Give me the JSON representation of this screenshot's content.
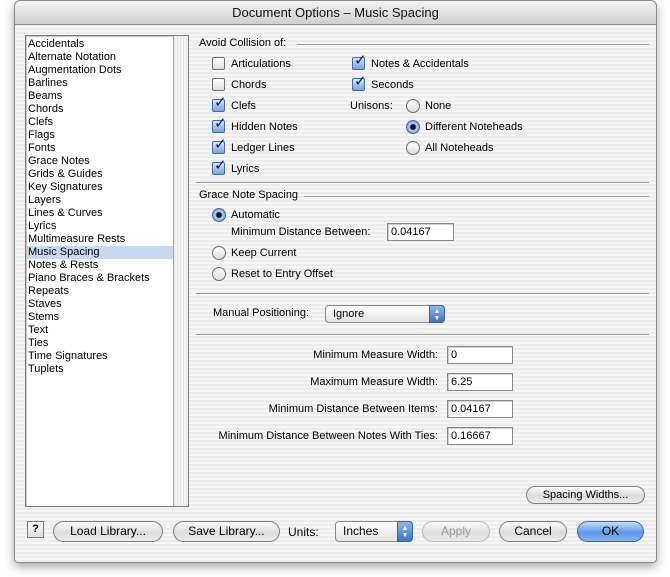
{
  "window": {
    "title": "Document Options – Music Spacing"
  },
  "sidebar": {
    "selected": "Music Spacing",
    "items": [
      "Accidentals",
      "Alternate Notation",
      "Augmentation Dots",
      "Barlines",
      "Beams",
      "Chords",
      "Clefs",
      "Flags",
      "Fonts",
      "Grace Notes",
      "Grids & Guides",
      "Key Signatures",
      "Layers",
      "Lines & Curves",
      "Lyrics",
      "Multimeasure Rests",
      "Music Spacing",
      "Notes & Rests",
      "Piano Braces & Brackets",
      "Repeats",
      "Staves",
      "Stems",
      "Text",
      "Ties",
      "Time Signatures",
      "Tuplets"
    ]
  },
  "avoid": {
    "label": "Avoid Collision of:",
    "articulations": {
      "label": "Articulations",
      "checked": false
    },
    "chords": {
      "label": "Chords",
      "checked": false
    },
    "clefs": {
      "label": "Clefs",
      "checked": true
    },
    "hidden_notes": {
      "label": "Hidden Notes",
      "checked": true
    },
    "ledger_lines": {
      "label": "Ledger Lines",
      "checked": true
    },
    "lyrics": {
      "label": "Lyrics",
      "checked": true
    },
    "notes_accidentals": {
      "label": "Notes & Accidentals",
      "checked": true
    },
    "seconds": {
      "label": "Seconds",
      "checked": true
    },
    "unisons_label": "Unisons:",
    "unisons_none": {
      "label": "None",
      "selected": false
    },
    "unisons_different": {
      "label": "Different Noteheads",
      "selected": true
    },
    "unisons_all": {
      "label": "All Noteheads",
      "selected": false
    }
  },
  "grace": {
    "label": "Grace Note Spacing",
    "automatic": {
      "label": "Automatic",
      "selected": true
    },
    "min_distance_label": "Minimum Distance Between:",
    "min_distance_value": "0.04167",
    "keep_current": {
      "label": "Keep Current",
      "selected": false
    },
    "reset_entry": {
      "label": "Reset to Entry Offset",
      "selected": false
    }
  },
  "manual": {
    "label": "Manual Positioning:",
    "value": "Ignore"
  },
  "measures": {
    "min_width_label": "Minimum Measure Width:",
    "min_width_value": "0",
    "max_width_label": "Maximum Measure Width:",
    "max_width_value": "6.25",
    "min_items_label": "Minimum Distance Between Items:",
    "min_items_value": "0.04167",
    "min_ties_label": "Minimum Distance Between Notes With Ties:",
    "min_ties_value": "0.16667"
  },
  "buttons": {
    "spacing_widths": "Spacing Widths...",
    "help": "?",
    "load_library": "Load Library...",
    "save_library": "Save Library...",
    "units_label": "Units:",
    "units_value": "Inches",
    "apply": "Apply",
    "cancel": "Cancel",
    "ok": "OK"
  }
}
